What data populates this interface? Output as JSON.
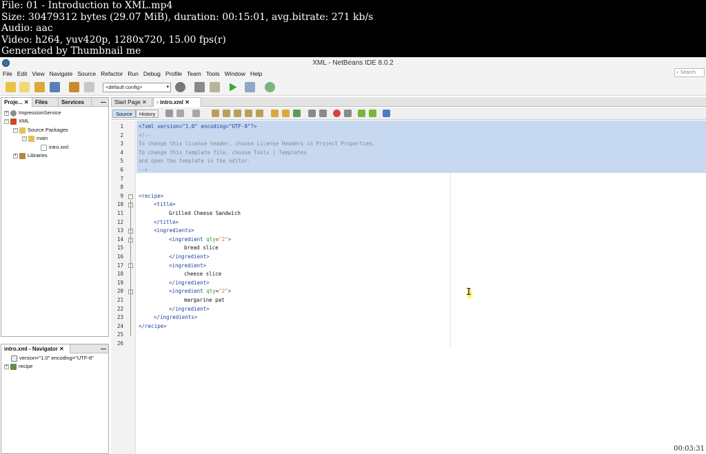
{
  "video_info": {
    "lines": [
      "File: 01 - Introduction to XML.mp4",
      "Size: 30479312 bytes (29.07 MiB), duration: 00:15:01, avg.bitrate: 271 kb/s",
      "Audio: aac",
      "Video: h264, yuv420p, 1280x720, 15.00 fps(r)",
      "Generated by Thumbnail me"
    ]
  },
  "window": {
    "title": "XML - NetBeans IDE 8.0.2"
  },
  "menu": [
    "File",
    "Edit",
    "View",
    "Navigate",
    "Source",
    "Refactor",
    "Run",
    "Debug",
    "Profile",
    "Team",
    "Tools",
    "Window",
    "Help"
  ],
  "search": {
    "placeholder": "Search"
  },
  "toolbar": {
    "config_select": "<default config>"
  },
  "project_panel": {
    "tabs": [
      "Proje...",
      "Files",
      "Services"
    ],
    "tree": [
      {
        "label": "ImpressionService"
      },
      {
        "label": "XML"
      },
      {
        "label": "Source Packages"
      },
      {
        "label": "main"
      },
      {
        "label": "intro.xml"
      },
      {
        "label": "Libraries"
      }
    ]
  },
  "navigator": {
    "title": "intro.xml - Navigator",
    "items": [
      {
        "label": "version=\"1.0\" encoding=\"UTF-8\""
      },
      {
        "label": "recipe"
      }
    ]
  },
  "editor": {
    "tabs": [
      "Start Page",
      "intro.xml"
    ],
    "modes": [
      "Source",
      "History"
    ],
    "line_numbers": [
      "1",
      "2",
      "3",
      "4",
      "5",
      "6",
      "7",
      "8",
      "9",
      "10",
      "11",
      "12",
      "13",
      "14",
      "15",
      "16",
      "17",
      "18",
      "19",
      "20",
      "21",
      "22",
      "23",
      "24",
      "25",
      "26"
    ],
    "code": {
      "l1_decl": "<?xml version=\"1.0\" encoding=\"UTF-8\"?>",
      "l2": "<!--",
      "l3": "To change this license header, choose License Headers in Project Properties.",
      "l4": "To change this template file, choose Tools | Templates",
      "l5": "and open the template in the editor.",
      "l6": "-->",
      "recipe_open": "<recipe>",
      "title_open": "<title>",
      "title_text": "Grilled Cheese Sandwich",
      "title_close": "</title>",
      "ingredients_open": "<ingredients>",
      "ingredient_tag": "<ingredient",
      "ingredient_tag_plain": "<ingredient>",
      "attr_qty": "qty",
      "attr_eq": "=",
      "val_2": "\"2\"",
      "gt": ">",
      "ing1": "bread slice",
      "ing2": "cheese slice",
      "ing3": "margarine pat",
      "ingredient_close": "</ingredient>",
      "ingredients_close": "</ingredients>",
      "recipe_close": "</recipe>"
    }
  },
  "timestamp": "00:03:31"
}
